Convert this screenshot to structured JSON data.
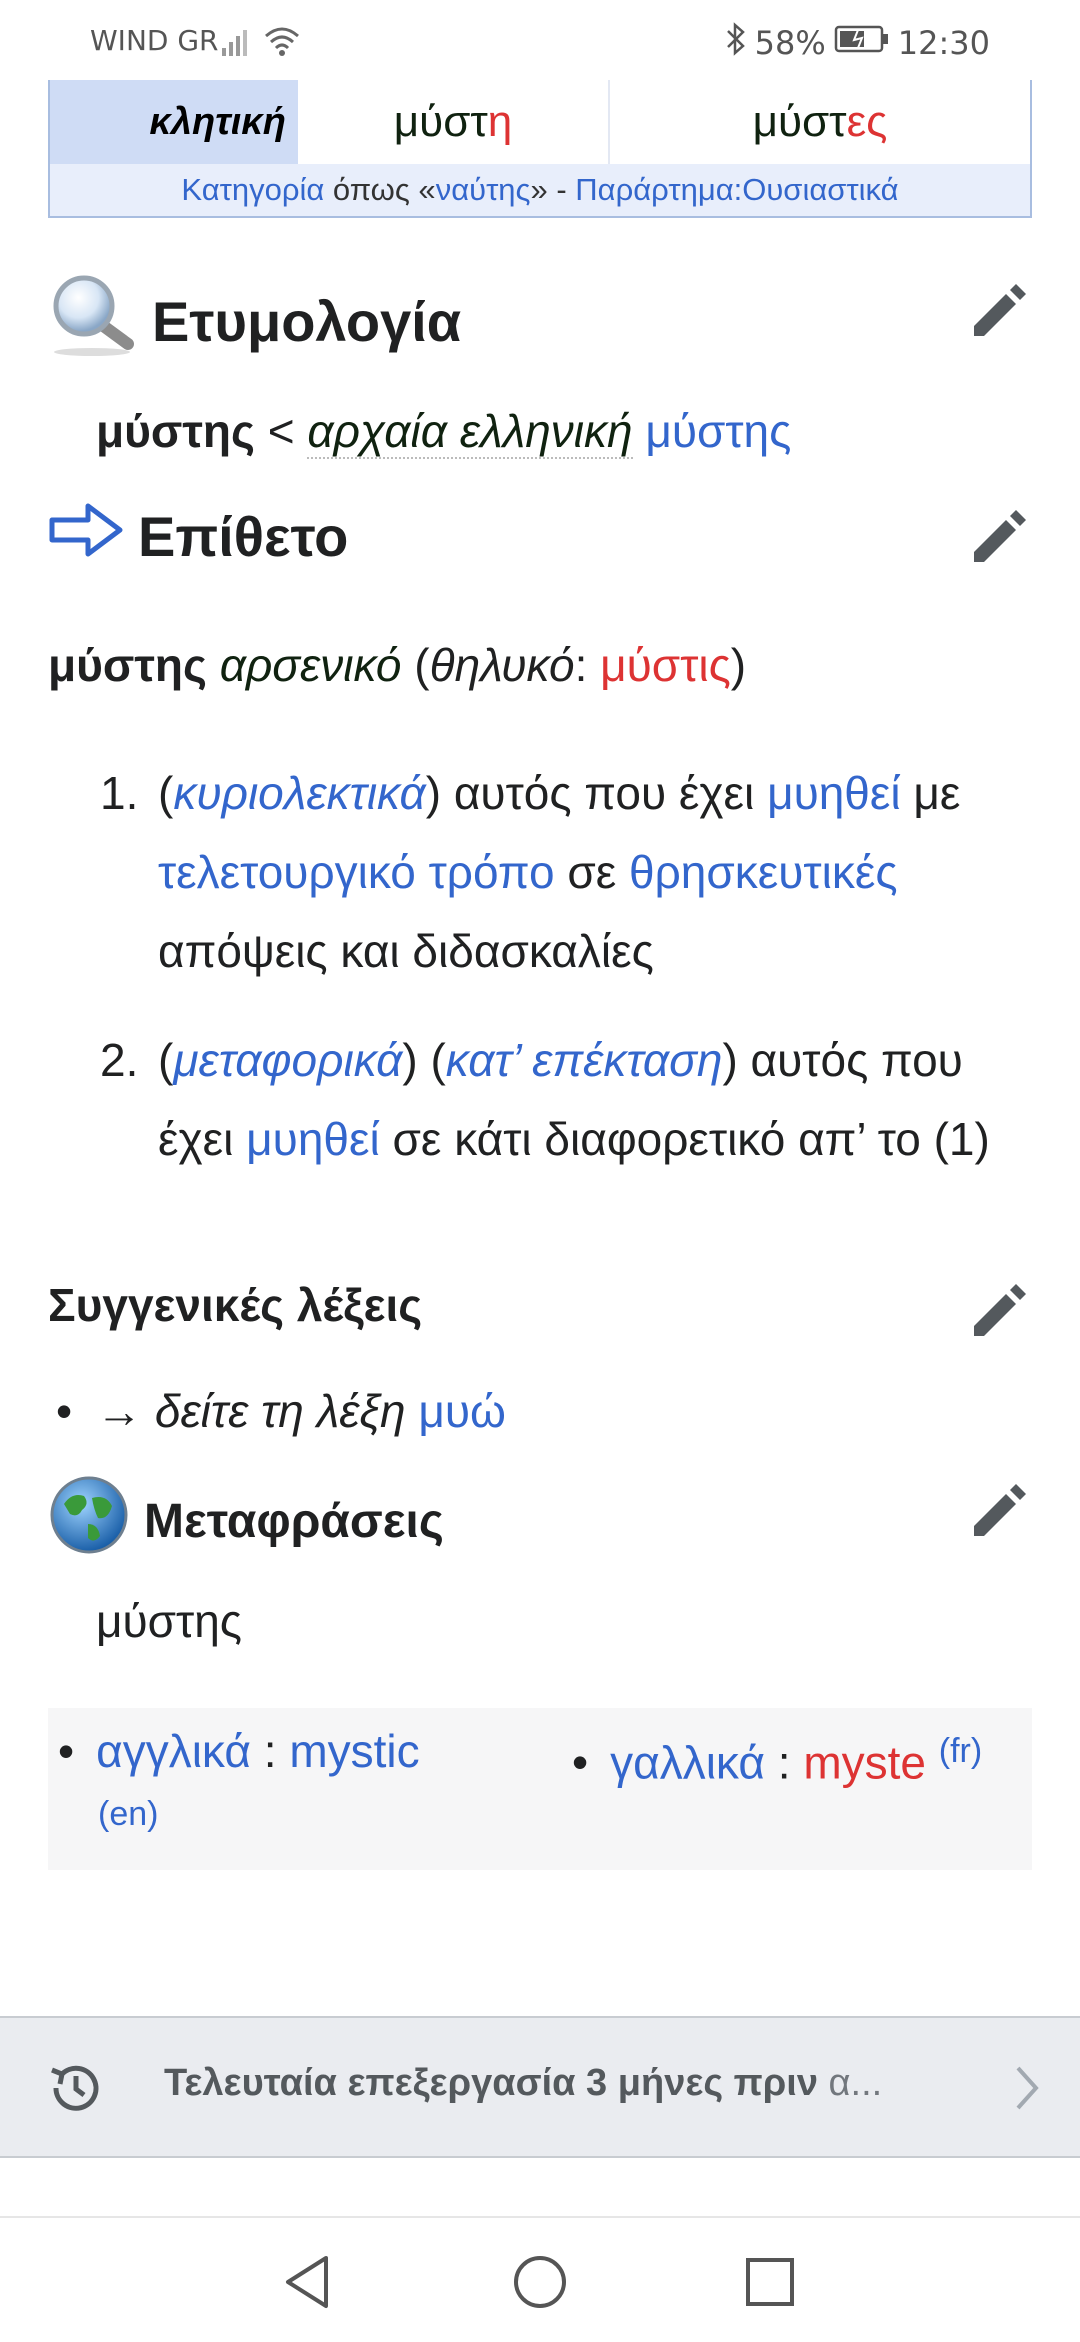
{
  "status_bar": {
    "carrier": "WIND GR",
    "battery": "58%",
    "time": "12:30"
  },
  "declension": {
    "case_label": "κλητική",
    "singular": {
      "stem": "μύστ",
      "ending": "η"
    },
    "plural": {
      "stem": "μύστ",
      "ending": "ες"
    },
    "footer": {
      "category": "Κατηγορία",
      "as": " όπως «",
      "model": "ναύτης",
      "close": "» - ",
      "appendix": "Παράρτημα:Ουσιαστικά"
    }
  },
  "etymology": {
    "heading": "Ετυμολογία",
    "headword": "μύστης",
    "sep": " < ",
    "lang": "αρχαία ελληνική",
    "source": "μύστης"
  },
  "adjective": {
    "heading": "Επίθετο",
    "headword": "μύστης",
    "gender": "αρσενικό",
    "fem_label": "θηλυκό",
    "fem_form": "μύστις",
    "definitions": [
      {
        "num": "1.",
        "qualifier": "κυριολεκτικά",
        "t1": " αυτός που έχει ",
        "l1": "μυηθεί",
        "t2": " με ",
        "l2": "τελετουργικό τρόπο",
        "t3": " σε ",
        "l3": "θρησκευτικές",
        "t4": " απόψεις και διδασκαλίες"
      },
      {
        "num": "2.",
        "qualifier1": "μεταφορικά",
        "qualifier2": "κατ’ επέκταση",
        "t1": " αυτός που έχει ",
        "l1": "μυηθεί",
        "t2": " σε κάτι διαφορετικό απ’ το (1)"
      }
    ]
  },
  "related": {
    "heading": "Συγγενικές λέξεις",
    "arrow": "→ ",
    "text": "δείτε τη λέξη ",
    "link": "μυώ"
  },
  "translations": {
    "heading": "Μεταφράσεις",
    "term": "μύστης",
    "items": [
      {
        "lang": "αγγλικά",
        "word": "mystic",
        "code": "(en)"
      },
      {
        "lang": "γαλλικά",
        "word": "myste",
        "code": "(fr)"
      }
    ]
  },
  "last_edit": {
    "text": "Τελευταία επεξεργασία 3 μήνες πριν",
    "trail": " α..."
  },
  "colors": {
    "link": "#3366cc",
    "redlink": "#dd3333",
    "table_header": "#cfdcf5",
    "text": "#202122"
  }
}
